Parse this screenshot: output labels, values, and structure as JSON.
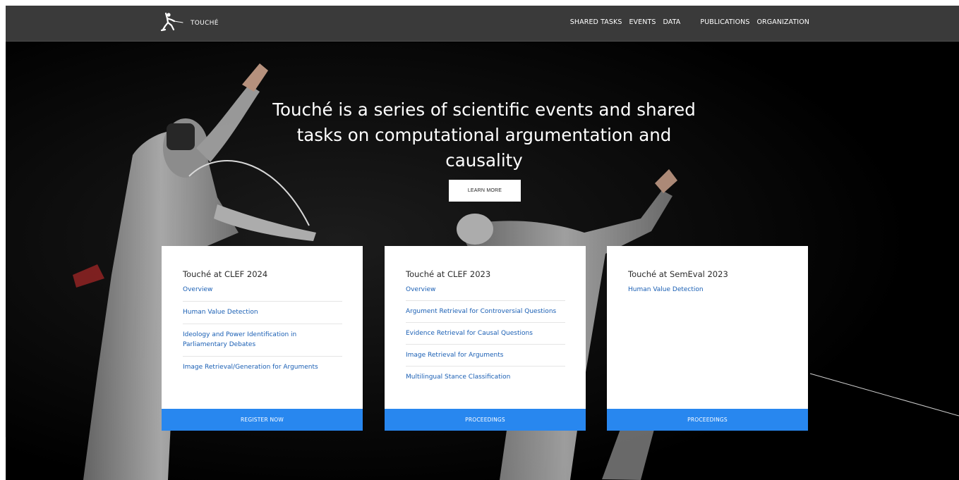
{
  "brand": {
    "name": "TOUCHÉ",
    "logo_icon": "fencer-logo-icon"
  },
  "nav": {
    "items": [
      "SHARED TASKS",
      "EVENTS",
      "DATA",
      "PUBLICATIONS",
      "ORGANIZATION"
    ]
  },
  "hero": {
    "title": "Touché is a series of scientific events and shared tasks on computational argumentation and causality",
    "button": "LEARN MORE"
  },
  "cards": [
    {
      "title": "Touché at CLEF 2024",
      "links": [
        "Overview",
        "Human Value Detection",
        "Ideology and Power Identification in Parliamentary Debates",
        "Image Retrieval/Generation for Arguments"
      ],
      "button": "REGISTER NOW"
    },
    {
      "title": "Touché at CLEF 2023",
      "links": [
        "Overview",
        "Argument Retrieval for Controversial Questions",
        "Evidence Retrieval for Causal Questions",
        "Image Retrieval for Arguments",
        "Multilingual Stance Classification"
      ],
      "button": "PROCEEDINGS"
    },
    {
      "title": "Touché at SemEval 2023",
      "links": [
        "Human Value Detection"
      ],
      "button": "PROCEEDINGS"
    }
  ],
  "colors": {
    "navbar": "#3a3a3a",
    "accent": "#2887ef",
    "link": "#1a5fb4",
    "background": "#000000"
  }
}
